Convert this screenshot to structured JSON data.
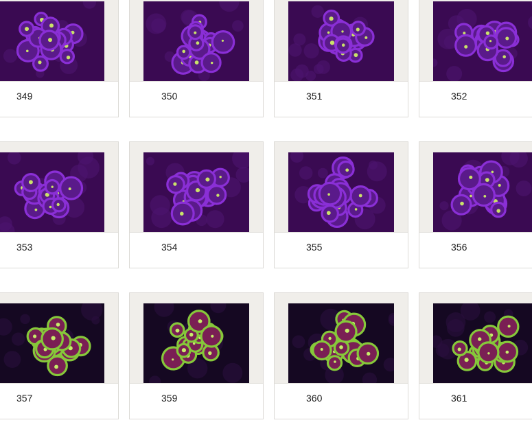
{
  "grid": {
    "items": [
      {
        "label": "349",
        "tone": "purple"
      },
      {
        "label": "350",
        "tone": "purple"
      },
      {
        "label": "351",
        "tone": "purple"
      },
      {
        "label": "352",
        "tone": "purple"
      },
      {
        "label": "353",
        "tone": "purple"
      },
      {
        "label": "354",
        "tone": "purple"
      },
      {
        "label": "355",
        "tone": "purple"
      },
      {
        "label": "356",
        "tone": "purple"
      },
      {
        "label": "357",
        "tone": "green"
      },
      {
        "label": "359",
        "tone": "green"
      },
      {
        "label": "360",
        "tone": "green"
      },
      {
        "label": "361",
        "tone": "green"
      }
    ]
  },
  "colors": {
    "mat": "#f0eeea",
    "purple_bg": "#3a0a52",
    "purple_coral": "#8a2fd6",
    "purple_accent": "#c9e26a",
    "green_bg": "#150822",
    "green_coral": "#86c83a",
    "green_accent": "#7a1f54"
  }
}
